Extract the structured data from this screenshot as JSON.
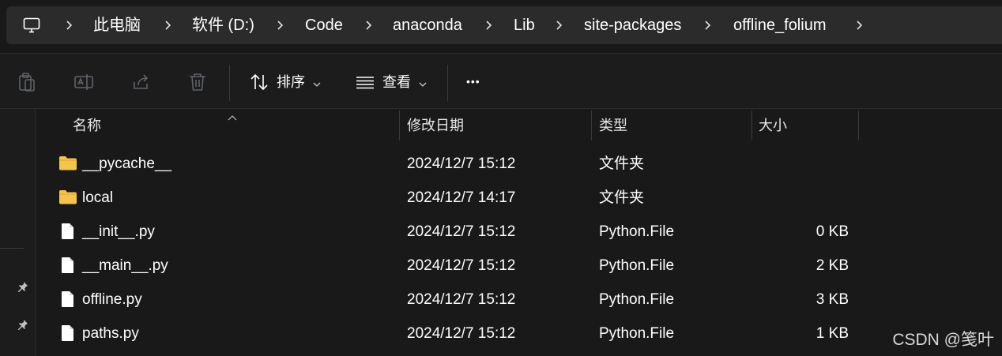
{
  "breadcrumb": {
    "items": [
      "此电脑",
      "软件 (D:)",
      "Code",
      "anaconda",
      "Lib",
      "site-packages",
      "offline_folium"
    ],
    "icon": "monitor-icon"
  },
  "toolbar": {
    "sort_label": "排序",
    "view_label": "查看",
    "more_label": "•••",
    "icons": [
      "clipboard-icon",
      "rename-icon",
      "share-icon",
      "trash-icon",
      "sort-icon",
      "view-list-icon"
    ]
  },
  "columns": {
    "name": "名称",
    "date": "修改日期",
    "type": "类型",
    "size": "大小"
  },
  "files": [
    {
      "name": "__pycache__",
      "date": "2024/12/7 15:12",
      "type": "文件夹",
      "size": "",
      "icon": "folder-icon"
    },
    {
      "name": "local",
      "date": "2024/12/7 14:17",
      "type": "文件夹",
      "size": "",
      "icon": "folder-icon"
    },
    {
      "name": "__init__.py",
      "date": "2024/12/7 15:12",
      "type": "Python.File",
      "size": "0 KB",
      "icon": "file-icon"
    },
    {
      "name": "__main__.py",
      "date": "2024/12/7 15:12",
      "type": "Python.File",
      "size": "2 KB",
      "icon": "file-icon"
    },
    {
      "name": "offline.py",
      "date": "2024/12/7 15:12",
      "type": "Python.File",
      "size": "3 KB",
      "icon": "file-icon"
    },
    {
      "name": "paths.py",
      "date": "2024/12/7 15:12",
      "type": "Python.File",
      "size": "1 KB",
      "icon": "file-icon"
    }
  ],
  "watermark": "CSDN @笺叶",
  "colors": {
    "background": "#191919",
    "folder": "#f4c54a",
    "text": "#ffffff"
  }
}
